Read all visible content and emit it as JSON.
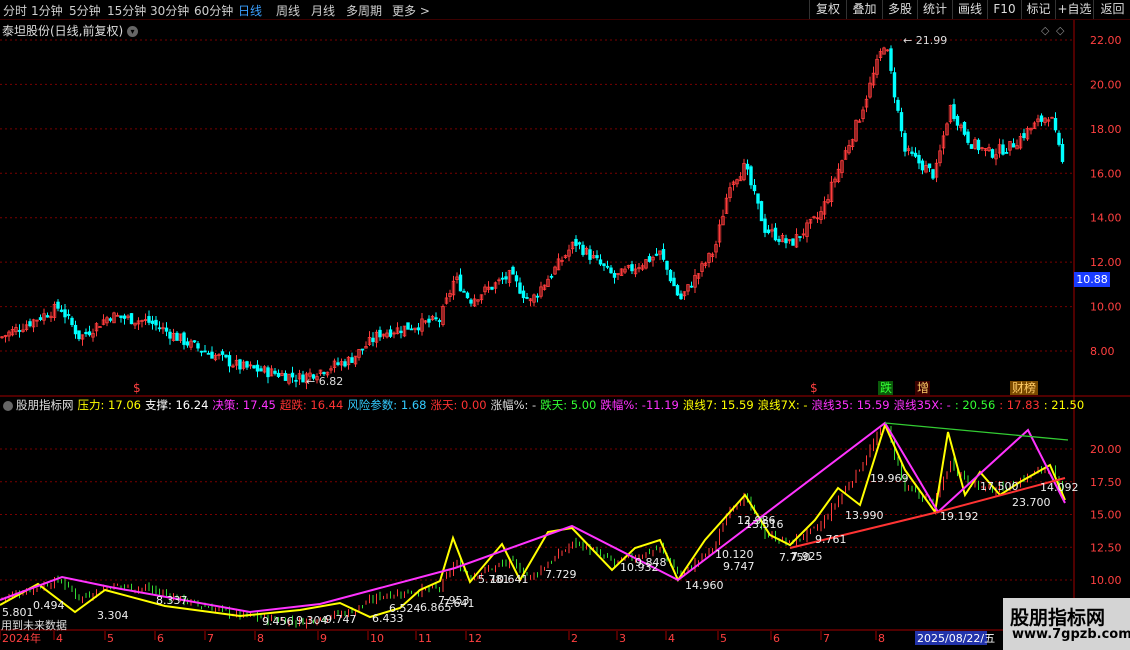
{
  "periods": [
    "分时",
    "1分钟",
    "5分钟",
    "15分钟",
    "30分钟",
    "60分钟",
    "日线",
    "周线",
    "月线",
    "多周期",
    "更多 >"
  ],
  "active_period": "日线",
  "toolbar_right": [
    "复权",
    "叠加",
    "多股",
    "统计",
    "画线",
    "F10",
    "标记",
    "+自选",
    "返回"
  ],
  "stock_title": "泰坦股份(日线,前复权)",
  "price_axis": [
    "22.00",
    "20.00",
    "18.00",
    "16.00",
    "14.00",
    "12.00",
    "10.00",
    "8.00"
  ],
  "current_price": "10.88",
  "high_label": "21.99",
  "low_label": "6.82",
  "event_markers": [
    "$",
    "$",
    "跌",
    "增",
    "财榜"
  ],
  "indicator": {
    "name": "股朋指标网",
    "items": [
      {
        "k": "压力",
        "v": "17.06",
        "color": "#ffff00"
      },
      {
        "k": "支撑",
        "v": "16.24",
        "color": "#ffffff"
      },
      {
        "k": "决策",
        "v": "17.45",
        "color": "#ff33ff"
      },
      {
        "k": "超跌",
        "v": "16.44",
        "color": "#ff3333"
      },
      {
        "k": "风险参数",
        "v": "1.68",
        "color": "#33ccff"
      },
      {
        "k": "涨天",
        "v": "0.00",
        "color": "#ff3333"
      },
      {
        "k": "涨幅%",
        "v": "-",
        "color": "#dddddd"
      },
      {
        "k": "跌天",
        "v": "5.00",
        "color": "#33ff33"
      },
      {
        "k": "跌幅%",
        "v": "-11.19",
        "color": "#ff33ff"
      },
      {
        "k": "浪线7",
        "v": "15.59",
        "color": "#ffff00"
      },
      {
        "k": "浪线7X",
        "v": "-",
        "color": "#ffff00"
      },
      {
        "k": "浪线35",
        "v": "15.59",
        "color": "#ff33ff"
      },
      {
        "k": "浪线35X",
        "v": "-",
        "color": "#ff33ff"
      },
      {
        "k": "",
        "v": "20.56",
        "color": "#33ff33"
      },
      {
        "k": "",
        "v": "17.83",
        "color": "#ff3333"
      },
      {
        "k": "",
        "v": "21.50",
        "color": "#ffff00"
      }
    ]
  },
  "indicator_axis": [
    "20.00",
    "17.50",
    "15.00",
    "12.50",
    "10.00"
  ],
  "indicator_labels": [
    "0.494",
    "5.801",
    "3.304",
    "8.337",
    "9.456",
    "9.304",
    "9.747",
    "6.433",
    "6.524",
    "6.865",
    "7.953",
    "7.641",
    "5.781",
    "10.641",
    "7.729",
    "9.848",
    "10.932",
    "14.960",
    "10.120",
    "9.747",
    "7.750",
    "7.925",
    "12.986",
    "13.516",
    "9.761",
    "13.990",
    "19.969",
    "19.192",
    "17.500",
    "23.700",
    "14.092"
  ],
  "date_axis": [
    "2024年",
    "4",
    "5",
    "6",
    "7",
    "8",
    "9",
    "10",
    "11",
    "12",
    "2",
    "3",
    "4",
    "5",
    "6",
    "7",
    "8",
    "9"
  ],
  "cursor_date": "2025/08/22/五",
  "future_note": "用到未来数据",
  "watermark": {
    "title": "股朋指标网",
    "url": "www.7gpzb.com"
  },
  "colors": {
    "up": "#ff3c3c",
    "down": "#00ffff",
    "grid": "#7a0000",
    "axis_text": "#ff4040"
  }
}
